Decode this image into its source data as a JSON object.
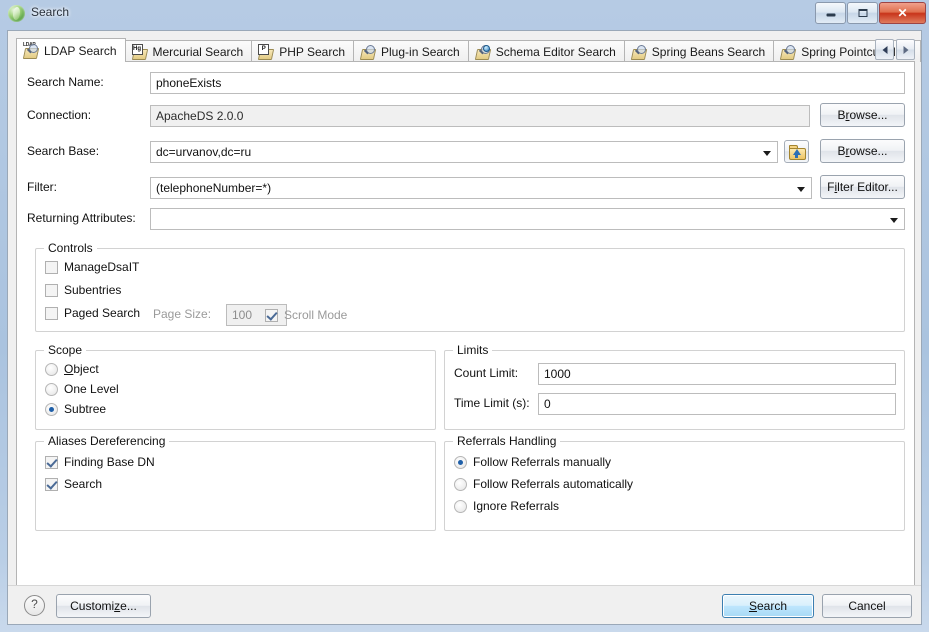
{
  "window": {
    "title": "Search",
    "icon": "app-globe-icon",
    "controls": {
      "minimize": "Minimize",
      "maximize": "Maximize",
      "close": "Close"
    }
  },
  "tabs": {
    "items": [
      {
        "label": "LDAP Search",
        "icon": "ldap-search-icon",
        "active": true
      },
      {
        "label": "Mercurial Search",
        "icon": "mercurial-search-icon",
        "active": false
      },
      {
        "label": "PHP Search",
        "icon": "php-search-icon",
        "active": false
      },
      {
        "label": "Plug-in Search",
        "icon": "plugin-search-icon",
        "active": false
      },
      {
        "label": "Schema Editor Search",
        "icon": "schema-editor-search-icon",
        "active": false
      },
      {
        "label": "Spring Beans Search",
        "icon": "spring-beans-search-icon",
        "active": false
      },
      {
        "label": "Spring Pointcut Matc",
        "icon": "spring-pointcut-search-icon",
        "active": false
      }
    ],
    "nav_prev": "◄",
    "nav_next": "►"
  },
  "form": {
    "search_name": {
      "label": "Search Name:",
      "value": "phoneExists"
    },
    "connection": {
      "label": "Connection:",
      "value": "ApacheDS 2.0.0",
      "browse": "Browse..."
    },
    "search_base": {
      "label": "Search Base:",
      "value": "dc=urvanov,dc=ru",
      "browse": "Browse...",
      "picker_icon": "folder-up-icon"
    },
    "filter": {
      "label": "Filter:",
      "value": "(telephoneNumber=*)",
      "editor": "Filter Editor..."
    },
    "returning_attributes": {
      "label": "Returning Attributes:",
      "value": ""
    }
  },
  "controls_group": {
    "title": "Controls",
    "manage_dsa_it": {
      "label": "ManageDsaIT",
      "checked": false
    },
    "subentries": {
      "label": "Subentries",
      "checked": false
    },
    "paged_search": {
      "label": "Paged Search",
      "checked": false
    },
    "page_size": {
      "label": "Page Size:",
      "value": "100",
      "disabled": true
    },
    "scroll_mode": {
      "label": "Scroll Mode",
      "checked": true,
      "disabled": true
    }
  },
  "scope_group": {
    "title": "Scope",
    "options": [
      {
        "label": "Object",
        "selected": false
      },
      {
        "label": "One Level",
        "selected": false
      },
      {
        "label": "Subtree",
        "selected": true
      }
    ]
  },
  "limits_group": {
    "title": "Limits",
    "count_limit": {
      "label": "Count Limit:",
      "value": "1000"
    },
    "time_limit": {
      "label": "Time Limit (s):",
      "value": "0"
    }
  },
  "aliases_group": {
    "title": "Aliases Dereferencing",
    "finding_base_dn": {
      "label": "Finding Base DN",
      "checked": true
    },
    "search": {
      "label": "Search",
      "checked": true
    }
  },
  "referrals_group": {
    "title": "Referrals Handling",
    "options": [
      {
        "label": "Follow Referrals manually",
        "selected": true
      },
      {
        "label": "Follow Referrals automatically",
        "selected": false
      },
      {
        "label": "Ignore Referrals",
        "selected": false
      }
    ]
  },
  "footer": {
    "help": "?",
    "customize": "Customize...",
    "search": "Search",
    "cancel": "Cancel"
  },
  "colors": {
    "titlebar": "#b0c6e0",
    "dialog_bg": "#f0f0f0",
    "page_bg": "#ffffff",
    "accent": "#1f5fa8",
    "default_button": "#bee6fd",
    "close_button": "#c8341a"
  }
}
